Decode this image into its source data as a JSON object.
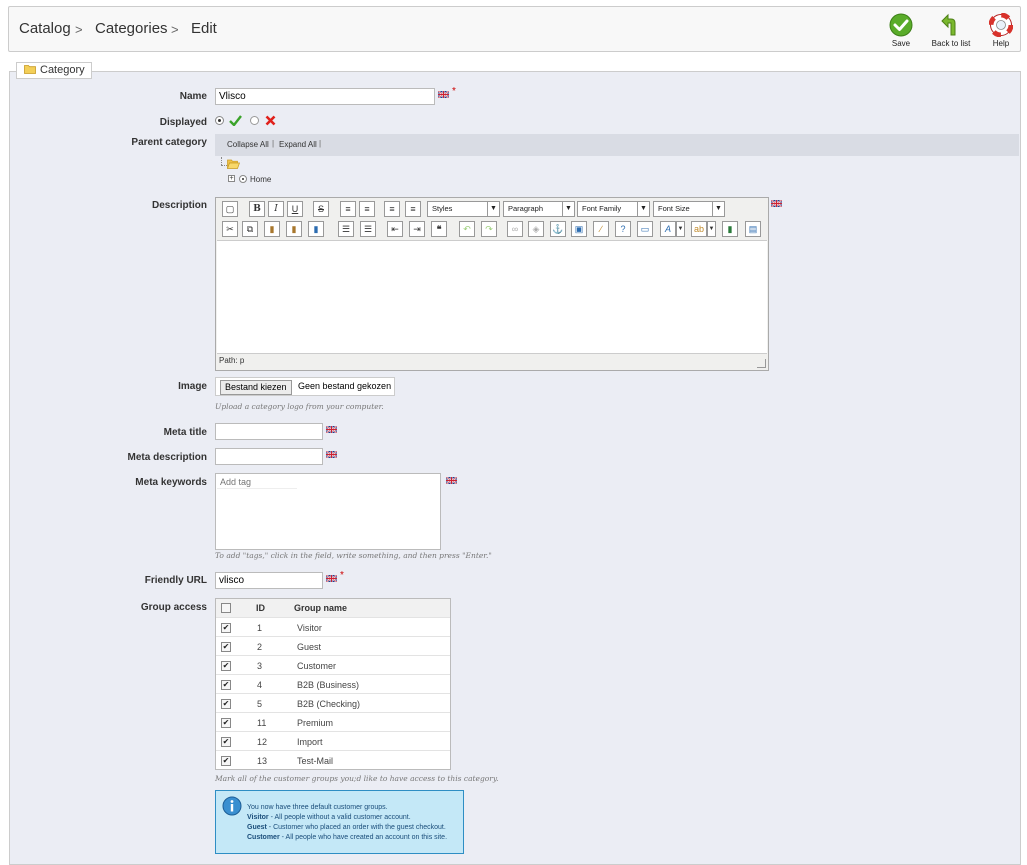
{
  "header": {
    "breadcrumb": [
      "Catalog",
      "Categories",
      "Edit"
    ],
    "actions": [
      {
        "name": "save",
        "label": "Save",
        "icon": "check-circle-icon",
        "color": "#5aac2a"
      },
      {
        "name": "back-to-list",
        "label": "Back to list",
        "icon": "back-arrow-icon",
        "color": "#6aa32c"
      },
      {
        "name": "help",
        "label": "Help",
        "icon": "lifebuoy-icon",
        "color": "#d8322b"
      }
    ]
  },
  "panel": {
    "legend": "Category",
    "legend_icon": "folder-icon"
  },
  "fields": {
    "name": {
      "label": "Name",
      "value": "Vlisco",
      "required": "*"
    },
    "displayed": {
      "label": "Displayed",
      "yes_icon": "check-icon",
      "no_icon": "cross-icon"
    },
    "parent": {
      "label": "Parent category",
      "collapse_all": "Collapse All",
      "expand_all": "Expand All",
      "sep": "|",
      "tree_root": "Home"
    },
    "description": {
      "label": "Description",
      "styles": "Styles",
      "paragraph": "Paragraph",
      "font_family": "Font Family",
      "font_size": "Font Size",
      "path": "Path: p"
    },
    "image": {
      "label": "Image",
      "choose_button": "Bestand kiezen",
      "no_file": "Geen bestand gekozen",
      "hint": "Upload a category logo from your computer."
    },
    "meta_title": {
      "label": "Meta title",
      "value": ""
    },
    "meta_description": {
      "label": "Meta description",
      "value": ""
    },
    "meta_keywords": {
      "label": "Meta keywords",
      "placeholder": "Add tag",
      "hint": "To add \"tags,\" click in the field, write something, and then press \"Enter.\""
    },
    "friendly_url": {
      "label": "Friendly URL",
      "value": "vlisco",
      "required": "*"
    },
    "group_access": {
      "label": "Group access",
      "col_id": "ID",
      "col_name": "Group name",
      "rows": [
        {
          "id": "1",
          "name": "Visitor",
          "checked": true
        },
        {
          "id": "2",
          "name": "Guest",
          "checked": true
        },
        {
          "id": "3",
          "name": "Customer",
          "checked": true
        },
        {
          "id": "4",
          "name": "B2B (Business)",
          "checked": true
        },
        {
          "id": "5",
          "name": "B2B (Checking)",
          "checked": true
        },
        {
          "id": "11",
          "name": "Premium",
          "checked": true
        },
        {
          "id": "12",
          "name": "Import",
          "checked": true
        },
        {
          "id": "13",
          "name": "Test-Mail",
          "checked": true
        }
      ],
      "hint": "Mark all of the customer groups you;d like to have access to this category."
    }
  },
  "info": {
    "line1": "You now have three default customer groups.",
    "visitor_title": "Visitor",
    "visitor_text": " - All people without a valid customer account.",
    "guest_title": "Guest",
    "guest_text": " - Customer who placed an order with the guest checkout.",
    "customer_title": "Customer",
    "customer_text": " - All people who have created an account on this site."
  }
}
